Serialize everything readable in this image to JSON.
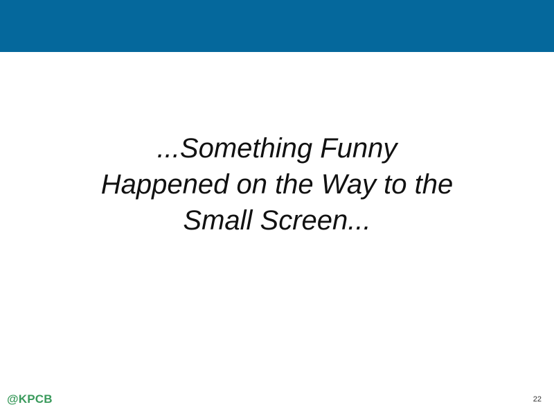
{
  "slide": {
    "title_lines": [
      "...Something Funny",
      "Happened on the Way to the",
      "Small Screen..."
    ],
    "footer_handle": "@KPCB",
    "page_number": "22"
  },
  "colors": {
    "header_band": "#05689c",
    "footer_handle": "#3a9a5c",
    "title_text": "#111111"
  }
}
